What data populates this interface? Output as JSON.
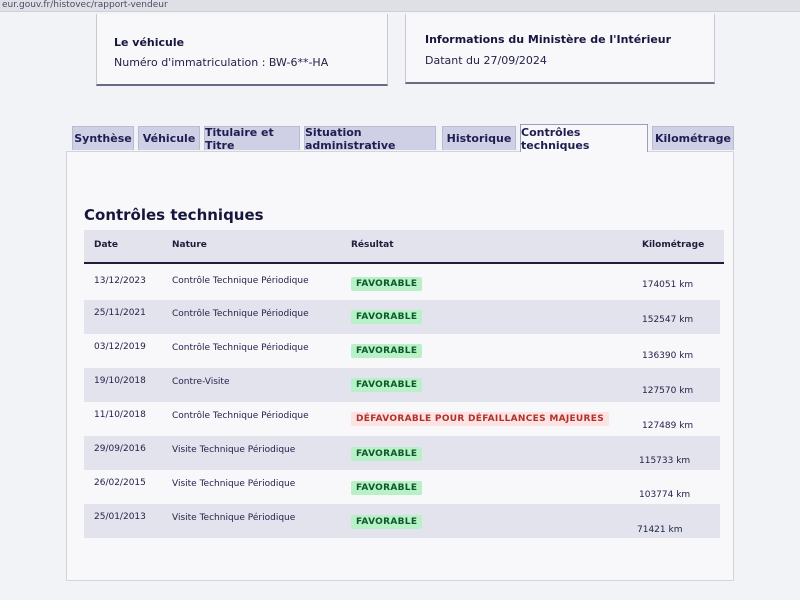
{
  "browser": {
    "url": "eur.gouv.fr/histovec/rapport-vendeur"
  },
  "vehicle_card": {
    "title": "Le véhicule",
    "registration": "Numéro d'immatriculation : BW-6**-HA"
  },
  "ministry_card": {
    "title": "Informations du Ministère de l'Intérieur",
    "date": "Datant du 27/09/2024"
  },
  "tabs": [
    {
      "label": "Synthèse"
    },
    {
      "label": "Véhicule"
    },
    {
      "label": "Titulaire et Titre"
    },
    {
      "label": "Situation administrative"
    },
    {
      "label": "Historique"
    },
    {
      "label": "Contrôles techniques",
      "active": true
    },
    {
      "label": "Kilométrage"
    }
  ],
  "section": {
    "title": "Contrôles techniques"
  },
  "table": {
    "headers": {
      "date": "Date",
      "nature": "Nature",
      "result": "Résultat",
      "mileage": "Kilométrage"
    },
    "rows": [
      {
        "date": "13/12/2023",
        "nature": "Contrôle Technique Périodique",
        "result": "FAVORABLE",
        "status": "ok",
        "mileage": "174051 km"
      },
      {
        "date": "25/11/2021",
        "nature": "Contrôle Technique Périodique",
        "result": "FAVORABLE",
        "status": "ok",
        "mileage": "152547 km"
      },
      {
        "date": "03/12/2019",
        "nature": "Contrôle Technique Périodique",
        "result": "FAVORABLE",
        "status": "ok",
        "mileage": "136390 km"
      },
      {
        "date": "19/10/2018",
        "nature": "Contre-Visite",
        "result": "FAVORABLE",
        "status": "ok",
        "mileage": "127570 km"
      },
      {
        "date": "11/10/2018",
        "nature": "Contrôle Technique Périodique",
        "result": "DÉFAVORABLE POUR DÉFAILLANCES MAJEURES",
        "status": "bad",
        "mileage": "127489 km"
      },
      {
        "date": "29/09/2016",
        "nature": "Visite Technique Périodique",
        "result": "FAVORABLE",
        "status": "ok",
        "mileage": "115733 km"
      },
      {
        "date": "26/02/2015",
        "nature": "Visite Technique Périodique",
        "result": "FAVORABLE",
        "status": "ok",
        "mileage": "103774 km"
      },
      {
        "date": "25/01/2013",
        "nature": "Visite Technique Périodique",
        "result": "FAVORABLE",
        "status": "ok",
        "mileage": "71421 km"
      }
    ]
  },
  "colors": {
    "favorable_bg": "#b8f0c8",
    "favorable_text": "#0c5a28",
    "unfavorable_bg": "#fde3e3",
    "unfavorable_text": "#b0322a",
    "tab_bg": "#cfd0e6"
  }
}
